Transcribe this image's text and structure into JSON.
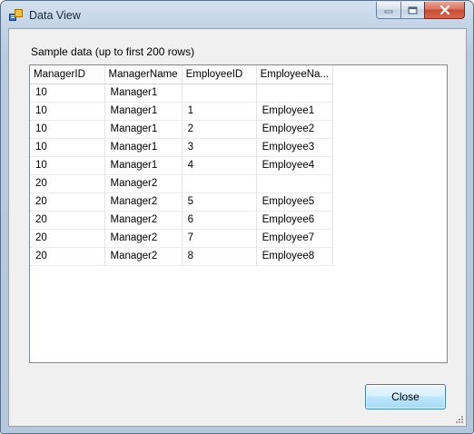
{
  "window": {
    "title": "Data View",
    "icon": "data-view-app-icon"
  },
  "caption_buttons": {
    "minimize_icon": "minimize-icon",
    "maximize_icon": "maximize-icon",
    "close_icon": "close-x-icon"
  },
  "main": {
    "caption": "Sample data (up to first 200 rows)",
    "grid": {
      "columns": [
        "ManagerID",
        "ManagerName",
        "EmployeeID",
        "EmployeeNa..."
      ],
      "rows": [
        [
          "10",
          "Manager1",
          "",
          ""
        ],
        [
          "10",
          "Manager1",
          "1",
          "Employee1"
        ],
        [
          "10",
          "Manager1",
          "2",
          "Employee2"
        ],
        [
          "10",
          "Manager1",
          "3",
          "Employee3"
        ],
        [
          "10",
          "Manager1",
          "4",
          "Employee4"
        ],
        [
          "20",
          "Manager2",
          "",
          ""
        ],
        [
          "20",
          "Manager2",
          "5",
          "Employee5"
        ],
        [
          "20",
          "Manager2",
          "6",
          "Employee6"
        ],
        [
          "20",
          "Manager2",
          "7",
          "Employee7"
        ],
        [
          "20",
          "Manager2",
          "8",
          "Employee8"
        ]
      ]
    }
  },
  "footer": {
    "close_label": "Close"
  }
}
